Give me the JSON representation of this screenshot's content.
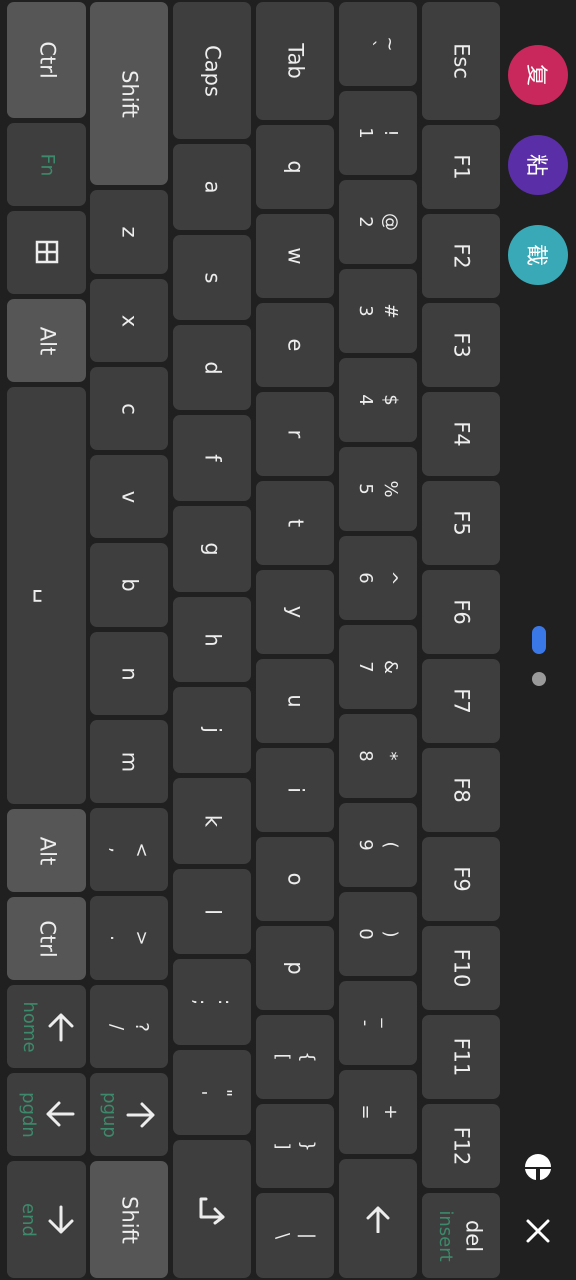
{
  "floating_buttons": {
    "copy_label": "复",
    "paste_label": "粘",
    "cut_label": "截",
    "copy_color": "#c8285b",
    "paste_color": "#5a2ea6",
    "cut_color": "#3aa9b7"
  },
  "pager": {
    "active_color": "#3b78e7",
    "inactive_color": "#9a9a9a",
    "page_count": 2,
    "active_index": 0
  },
  "keys": {
    "esc": "Esc",
    "f1": "F1",
    "f2": "F2",
    "f3": "F3",
    "f4": "F4",
    "f5": "F5",
    "f6": "F6",
    "f7": "F7",
    "f8": "F8",
    "f9": "F9",
    "f10": "F10",
    "f11": "F11",
    "f12": "F12",
    "del": "del",
    "del_secondary": "insert",
    "tilde_top": "~",
    "tilde_bottom": "`",
    "n1_top": "!",
    "n1": "1",
    "n2_top": "@",
    "n2": "2",
    "n3_top": "#",
    "n3": "3",
    "n4_top": "$",
    "n4": "4",
    "n5_top": "%",
    "n5": "5",
    "n6_top": "^",
    "n6": "6",
    "n7_top": "&",
    "n7": "7",
    "n8_top": "*",
    "n8": "8",
    "n9_top": "(",
    "n9": "9",
    "n0_top": ")",
    "n0": "0",
    "minus_top": "_",
    "minus": "-",
    "equal_top": "+",
    "equal": "=",
    "tab": "Tab",
    "q": "q",
    "w": "w",
    "e": "e",
    "r": "r",
    "t": "t",
    "y": "y",
    "u": "u",
    "i": "i",
    "o": "o",
    "p": "p",
    "lbracket_top": "{",
    "lbracket": "[",
    "rbracket_top": "}",
    "rbracket": "]",
    "backslash_top": "|",
    "backslash": "\\",
    "caps": "Caps",
    "a": "a",
    "s": "s",
    "d": "d",
    "f": "f",
    "g": "g",
    "h": "h",
    "j": "j",
    "k": "k",
    "l": "l",
    "semicolon_top": ":",
    "semicolon": ";",
    "quote_top": "\"",
    "quote": "'",
    "shift": "Shift",
    "z": "z",
    "x": "x",
    "c": "c",
    "v": "v",
    "b": "b",
    "n": "n",
    "m": "m",
    "comma_top": "<",
    "comma": ",",
    "period_top": ">",
    "period": ".",
    "slash_top": "?",
    "slash": "/",
    "pgup": "pgup",
    "shift_right": "Shift",
    "ctrl": "Ctrl",
    "fn": "Fn",
    "alt": "Alt",
    "space": "␣",
    "alt_right": "Alt",
    "ctrl_right": "Ctrl",
    "home": "home",
    "pgdn": "pgdn",
    "end": "end"
  }
}
